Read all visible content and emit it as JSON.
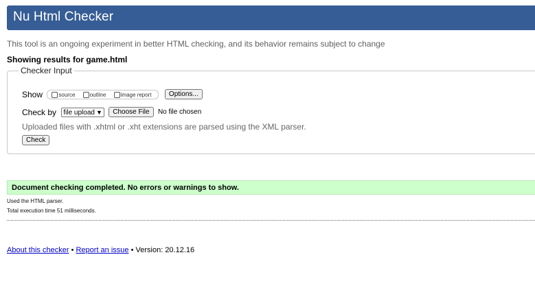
{
  "header": {
    "title": "Nu Html Checker"
  },
  "tagline": "This tool is an ongoing experiment in better HTML checking, and its behavior remains subject to change",
  "showing": "Showing results for game.html",
  "checker_input": {
    "legend": "Checker Input",
    "show_label": "Show",
    "show_options": [
      {
        "label": "source",
        "checked": false
      },
      {
        "label": "outline",
        "checked": false
      },
      {
        "label": "image report",
        "checked": false
      }
    ],
    "options_button": "Options...",
    "check_by_label": "Check by",
    "check_by_selected": "file upload",
    "choose_file_button": "Choose File",
    "no_file_text": "No file chosen",
    "hint": "Uploaded files with .xhtml or .xht extensions are parsed using the XML parser.",
    "check_button": "Check"
  },
  "result": {
    "success_message": "Document checking completed. No errors or warnings to show.",
    "success_color": "#ccffcc",
    "parser_note": "Used the HTML parser.",
    "execution_time": "Total execution time 51 milliseconds."
  },
  "footer": {
    "about_link": "About this checker",
    "separator": "•",
    "report_link": "Report an issue",
    "version": "Version: 20.12.16"
  },
  "colors": {
    "header_bg": "#365d95",
    "link": "#0000cc"
  }
}
